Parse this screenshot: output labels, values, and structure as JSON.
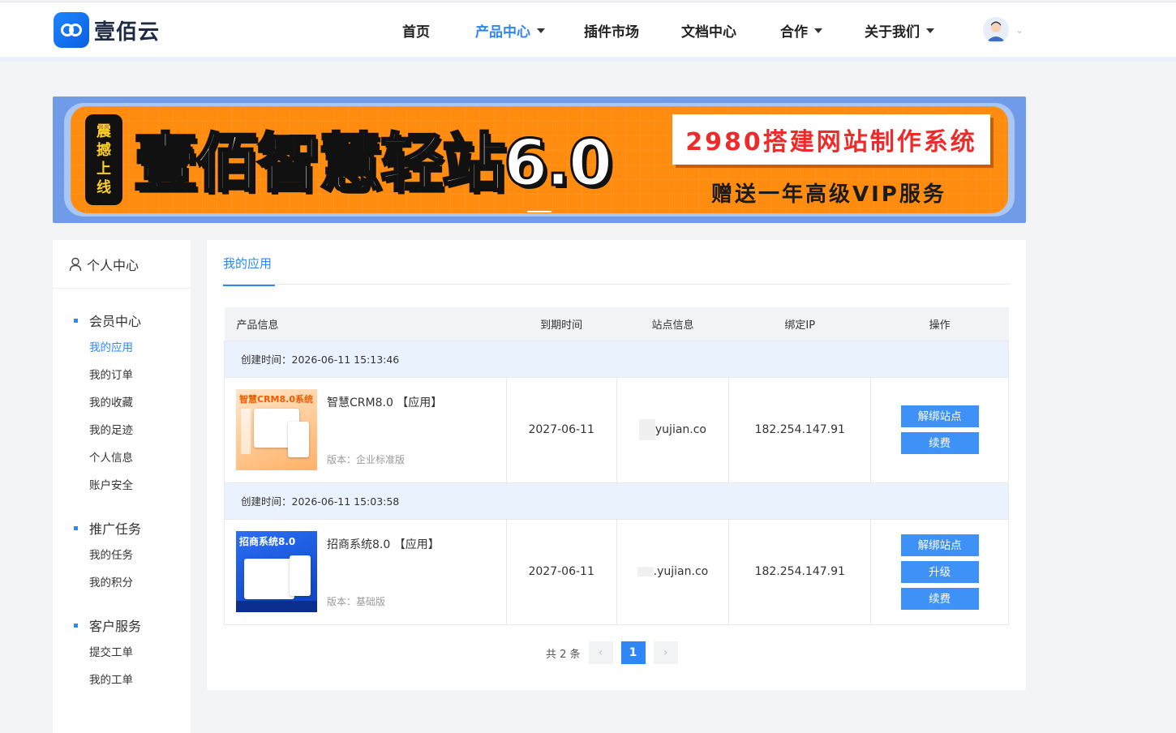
{
  "brand": {
    "logo_text": "壹佰云"
  },
  "nav": {
    "items": [
      {
        "label": "首页",
        "dropdown": false,
        "active": false
      },
      {
        "label": "产品中心",
        "dropdown": true,
        "active": true
      },
      {
        "label": "插件市场",
        "dropdown": false,
        "active": false
      },
      {
        "label": "文档中心",
        "dropdown": false,
        "active": false
      },
      {
        "label": "合作",
        "dropdown": true,
        "active": false
      },
      {
        "label": "关于我们",
        "dropdown": true,
        "active": false
      }
    ]
  },
  "banner": {
    "badge": [
      "震",
      "撼",
      "上",
      "线"
    ],
    "title": "壹佰智慧轻站6.0",
    "price_text": "2980搭建网站制作系统",
    "gift_text": "赠送一年高级VIP服务"
  },
  "sidebar": {
    "header": "个人中心",
    "groups": [
      {
        "title": "会员中心",
        "links": [
          "我的应用",
          "我的订单",
          "我的收藏",
          "我的足迹",
          "个人信息",
          "账户安全"
        ]
      },
      {
        "title": "推广任务",
        "links": [
          "我的任务",
          "我的积分"
        ]
      },
      {
        "title": "客户服务",
        "links": [
          "提交工单",
          "我的工单"
        ]
      }
    ],
    "active_link": "我的应用"
  },
  "main": {
    "tab": "我的应用",
    "columns": [
      "产品信息",
      "到期时间",
      "站点信息",
      "绑定IP",
      "操作"
    ],
    "rows": [
      {
        "created": "创建时间：2026-06-11 15:13:46",
        "thumb_text": "智慧CRM8.0系统",
        "name": "智慧CRM8.0 【应用】",
        "version": "版本：企业标准版",
        "expire": "2027-06-11",
        "site": "yujian.co",
        "ip": "182.254.147.91",
        "actions": [
          "解绑站点",
          "续费"
        ]
      },
      {
        "created": "创建时间：2026-06-11 15:03:58",
        "thumb_text": "招商系统8.0",
        "name": "招商系统8.0 【应用】",
        "version": "版本：基础版",
        "expire": "2027-06-11",
        "site": ".yujian.co",
        "ip": "182.254.147.91",
        "actions": [
          "解绑站点",
          "升级",
          "续费"
        ]
      }
    ],
    "pagination": {
      "total_text": "共 2 条",
      "current": "1",
      "prev": "‹",
      "next": "›"
    }
  },
  "colors": {
    "accent": "#2f86f6",
    "banner_orange": "#ff8c0f",
    "button": "#3e91f7"
  }
}
